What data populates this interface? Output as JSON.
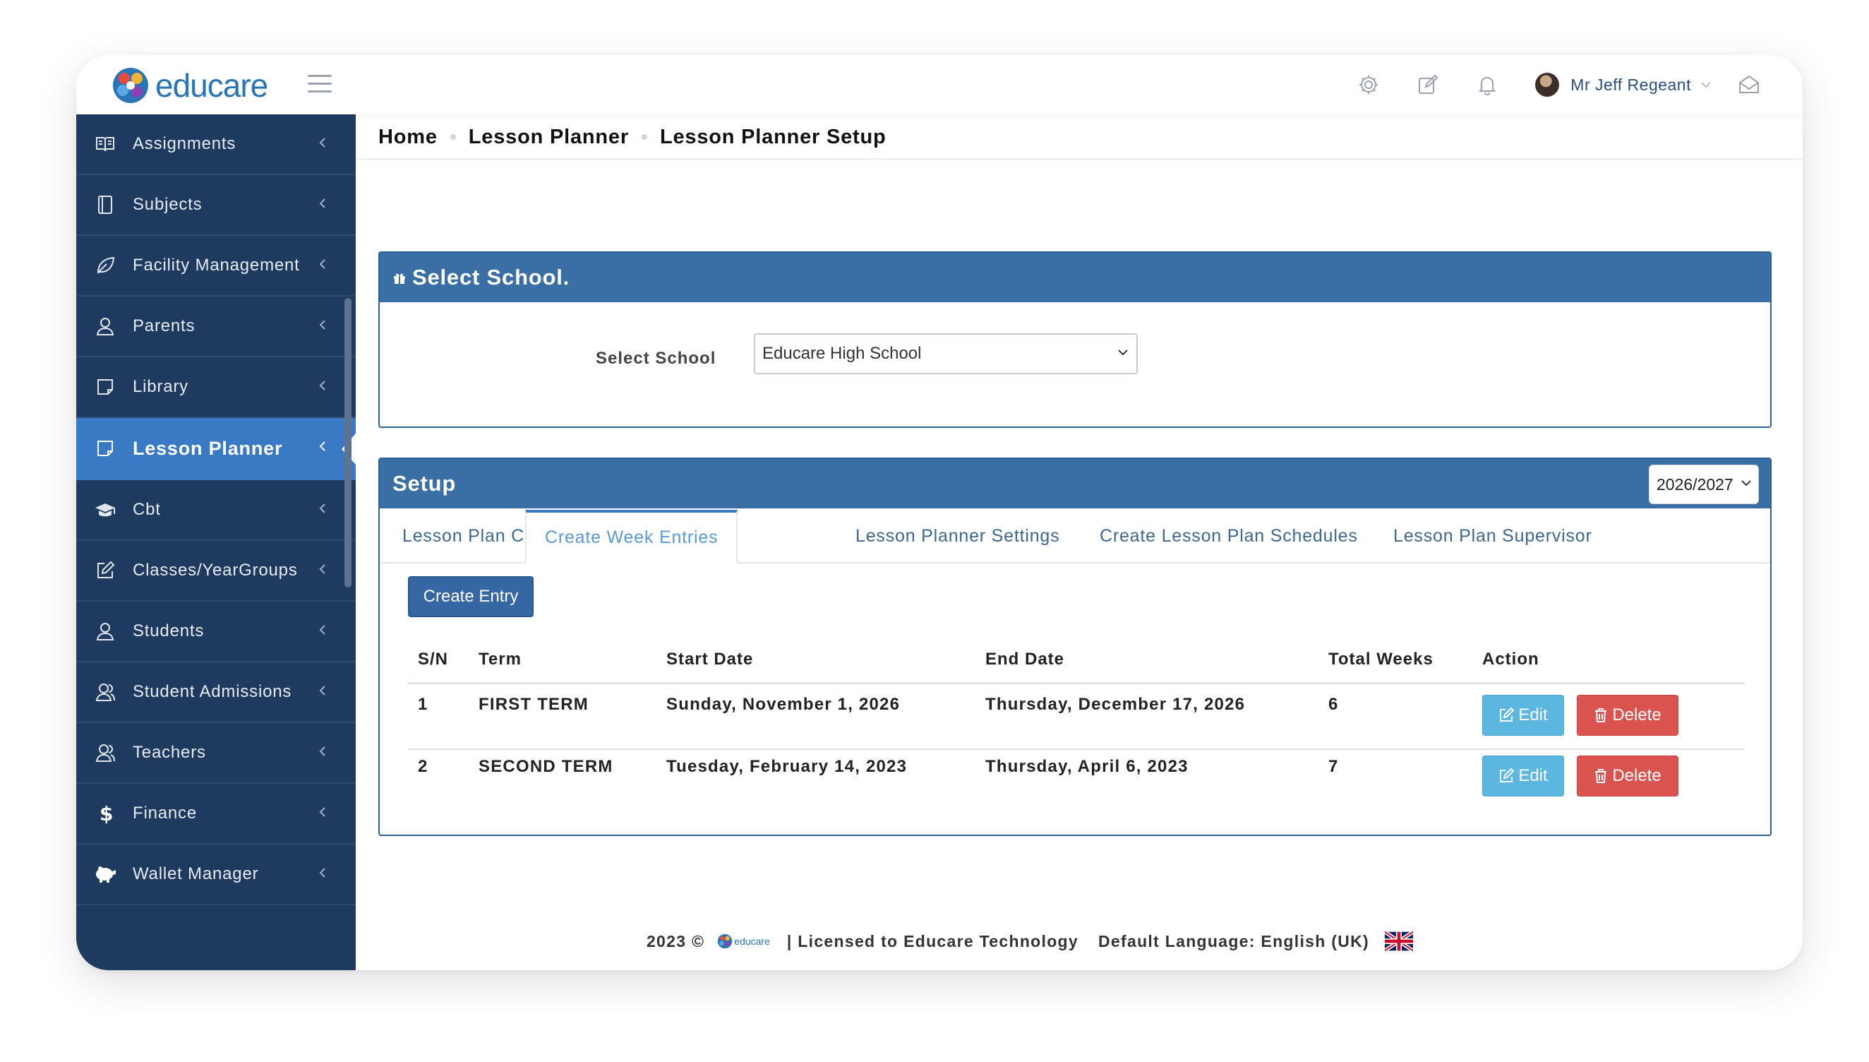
{
  "brand": {
    "name": "educare"
  },
  "header": {
    "user_name": "Mr Jeff Regeant",
    "icons": [
      "settings-icon",
      "compose-icon",
      "bell-icon",
      "mail-open-icon"
    ]
  },
  "sidebar": {
    "items": [
      {
        "label": "Assignments",
        "icon": "book-open-icon"
      },
      {
        "label": "Subjects",
        "icon": "notebook-icon"
      },
      {
        "label": "Facility Management",
        "icon": "leaf-icon"
      },
      {
        "label": "Parents",
        "icon": "user-icon"
      },
      {
        "label": "Library",
        "icon": "note-icon"
      },
      {
        "label": "Lesson Planner",
        "icon": "note-icon",
        "active": true
      },
      {
        "label": "Cbt",
        "icon": "graduation-cap-icon"
      },
      {
        "label": "Classes/YearGroups",
        "icon": "edit-square-icon"
      },
      {
        "label": "Students",
        "icon": "user-icon"
      },
      {
        "label": "Student Admissions",
        "icon": "users-icon"
      },
      {
        "label": "Teachers",
        "icon": "users-icon"
      },
      {
        "label": "Finance",
        "icon": "dollar-icon"
      },
      {
        "label": "Wallet Manager",
        "icon": "piggy-bank-icon"
      }
    ]
  },
  "breadcrumb": [
    "Home",
    "Lesson Planner",
    "Lesson Planner Setup"
  ],
  "school_panel": {
    "title": "Select School.",
    "label": "Select School",
    "selected": "Educare High School"
  },
  "setup_panel": {
    "title": "Setup",
    "year": "2026/2027",
    "tabs": [
      "Lesson Plan Categories",
      "Create Week Entries",
      "Lesson Planner Settings",
      "Create Lesson Plan Schedules",
      "Lesson Plan Supervisor"
    ],
    "active_tab": "Create Week Entries",
    "create_button": "Create Entry",
    "columns": [
      "S/N",
      "Term",
      "Start Date",
      "End Date",
      "Total Weeks",
      "Action"
    ],
    "rows": [
      {
        "sn": "1",
        "term": "FIRST TERM",
        "start": "Sunday, November 1, 2026",
        "end": "Thursday, December 17, 2026",
        "weeks": "6"
      },
      {
        "sn": "2",
        "term": "SECOND TERM",
        "start": "Tuesday, February 14, 2023",
        "end": "Thursday, April 6, 2023",
        "weeks": "7"
      }
    ],
    "edit_label": "Edit",
    "delete_label": "Delete"
  },
  "footer": {
    "copyright": "2023 ©",
    "logo_text": "educare",
    "license": "| Licensed to Educare Technology",
    "language": "Default Language: English (UK)"
  },
  "colors": {
    "sidebar": "#1e3a5f",
    "sidebar_active": "#3a7ac4",
    "panel_header": "#3a6fa6",
    "edit": "#5bb6e0",
    "delete": "#d9534f"
  }
}
